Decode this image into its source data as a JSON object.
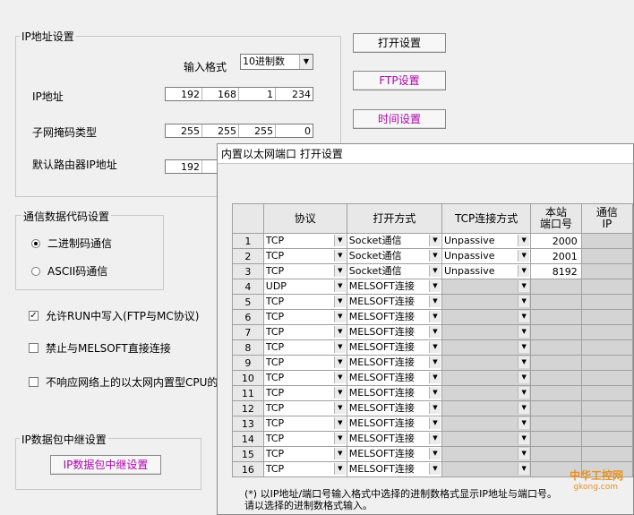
{
  "ip_settings": {
    "title": "IP地址设置",
    "input_format_label": "输入格式",
    "input_format_value": "10进制数",
    "ip_label": "IP地址",
    "ip": [
      "192",
      "168",
      "1",
      "234"
    ],
    "subnet_label": "子网掩码类型",
    "subnet": [
      "255",
      "255",
      "255",
      "0"
    ],
    "gateway_label": "默认路由器IP地址",
    "gateway": [
      "192",
      "",
      "",
      ""
    ]
  },
  "buttons": {
    "open_settings": "打开设置",
    "ftp_settings": "FTP设置",
    "time_settings": "时间设置",
    "ip_relay_settings": "IP数据包中继设置"
  },
  "comm_code": {
    "title": "通信数据代码设置",
    "binary": "二进制码通信",
    "ascii": "ASCII码通信",
    "selected": "binary"
  },
  "checks": {
    "allow_run_write": "允许RUN中写入(FTP与MC协议)",
    "allow_run_write_checked": true,
    "disable_melsoft": "禁止与MELSOFT直接连接",
    "disable_melsoft_checked": false,
    "no_response": "不响应网络上的以太网内置型CPU的搜",
    "no_response_checked": false
  },
  "relay": {
    "title": "IP数据包中继设置"
  },
  "dialog": {
    "title": "内置以太网端口 打开设置",
    "headers": {
      "protocol": "协议",
      "open_method": "打开方式",
      "tcp_conn": "TCP连接方式",
      "local_port": "本站\n端口号",
      "comm_target": "通信\nIP"
    },
    "rows": [
      {
        "no": "1",
        "protocol": "TCP",
        "open": "Socket通信",
        "tcp": "Unpassive",
        "port": "2000"
      },
      {
        "no": "2",
        "protocol": "TCP",
        "open": "Socket通信",
        "tcp": "Unpassive",
        "port": "2001"
      },
      {
        "no": "3",
        "protocol": "TCP",
        "open": "Socket通信",
        "tcp": "Unpassive",
        "port": "8192"
      },
      {
        "no": "4",
        "protocol": "UDP",
        "open": "MELSOFT连接",
        "tcp": "",
        "port": ""
      },
      {
        "no": "5",
        "protocol": "TCP",
        "open": "MELSOFT连接",
        "tcp": "",
        "port": ""
      },
      {
        "no": "6",
        "protocol": "TCP",
        "open": "MELSOFT连接",
        "tcp": "",
        "port": ""
      },
      {
        "no": "7",
        "protocol": "TCP",
        "open": "MELSOFT连接",
        "tcp": "",
        "port": ""
      },
      {
        "no": "8",
        "protocol": "TCP",
        "open": "MELSOFT连接",
        "tcp": "",
        "port": ""
      },
      {
        "no": "9",
        "protocol": "TCP",
        "open": "MELSOFT连接",
        "tcp": "",
        "port": ""
      },
      {
        "no": "10",
        "protocol": "TCP",
        "open": "MELSOFT连接",
        "tcp": "",
        "port": ""
      },
      {
        "no": "11",
        "protocol": "TCP",
        "open": "MELSOFT连接",
        "tcp": "",
        "port": ""
      },
      {
        "no": "12",
        "protocol": "TCP",
        "open": "MELSOFT连接",
        "tcp": "",
        "port": ""
      },
      {
        "no": "13",
        "protocol": "TCP",
        "open": "MELSOFT连接",
        "tcp": "",
        "port": ""
      },
      {
        "no": "14",
        "protocol": "TCP",
        "open": "MELSOFT连接",
        "tcp": "",
        "port": ""
      },
      {
        "no": "15",
        "protocol": "TCP",
        "open": "MELSOFT连接",
        "tcp": "",
        "port": ""
      },
      {
        "no": "16",
        "protocol": "TCP",
        "open": "MELSOFT连接",
        "tcp": "",
        "port": ""
      }
    ],
    "note_line1": "(*) 以IP地址/端口号输入格式中选择的进制数格式显示IP地址与端口号。",
    "note_line2": "请以选择的进制数格式输入。"
  },
  "watermark": {
    "text": "中华工控网",
    "url": "gkong.com"
  },
  "colors": {
    "purple_button_text": "#b000b0",
    "watermark": "#e8901e"
  }
}
